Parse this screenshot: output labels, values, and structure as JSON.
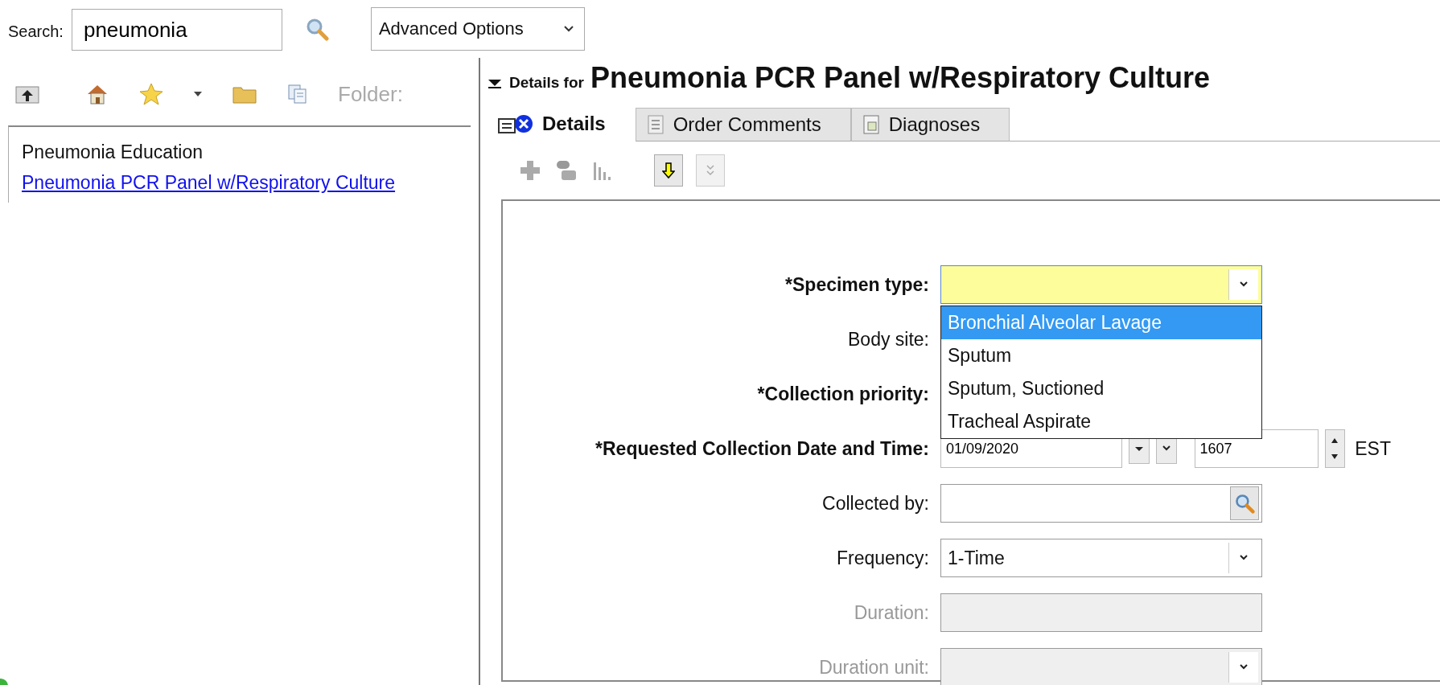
{
  "search": {
    "label": "Search:",
    "value": "pneumonia"
  },
  "advanced_options": {
    "label": "Advanced Options"
  },
  "folder_toolbar": {
    "folder_label": "Folder:"
  },
  "folder_items": [
    {
      "text": "Pneumonia Education",
      "kind": "plain"
    },
    {
      "text": "Pneumonia PCR Panel w/Respiratory Culture",
      "kind": "link"
    }
  ],
  "details": {
    "prefix": "Details for",
    "title": "Pneumonia PCR Panel w/Respiratory Culture",
    "expanded": true
  },
  "tabs": [
    {
      "label": "Details",
      "selected": true,
      "kind": "details"
    },
    {
      "label": "Order Comments",
      "selected": false,
      "kind": "comments"
    },
    {
      "label": "Diagnoses",
      "selected": false,
      "kind": "diagnoses"
    }
  ],
  "form": {
    "fields": [
      {
        "label": "*Specimen type:",
        "required": true,
        "disabled": false,
        "kind": "dropdown",
        "highlighted": true
      },
      {
        "label": "Body site:",
        "required": false,
        "disabled": false,
        "kind": "covered"
      },
      {
        "label": "*Collection priority:",
        "required": true,
        "disabled": false,
        "kind": "covered"
      },
      {
        "label": "*Requested Collection Date and Time:",
        "required": true,
        "disabled": false,
        "kind": "datetime",
        "date": "01/09/2020",
        "time": "1607",
        "zone": "EST"
      },
      {
        "label": "Collected by:",
        "required": false,
        "disabled": false,
        "kind": "lookup"
      },
      {
        "label": "Frequency:",
        "required": false,
        "disabled": false,
        "kind": "dropdown",
        "value": "1-Time",
        "highlighted": false
      },
      {
        "label": "Duration:",
        "required": false,
        "disabled": true,
        "kind": "text"
      },
      {
        "label": "Duration unit:",
        "required": false,
        "disabled": true,
        "kind": "dropdown",
        "highlighted": false
      }
    ],
    "open_list": {
      "options": [
        {
          "label": "Bronchial Alveolar Lavage",
          "selected": true
        },
        {
          "label": "Sputum",
          "selected": false
        },
        {
          "label": "Sputum, Suctioned",
          "selected": false
        },
        {
          "label": "Tracheal Aspirate",
          "selected": false
        }
      ]
    }
  }
}
